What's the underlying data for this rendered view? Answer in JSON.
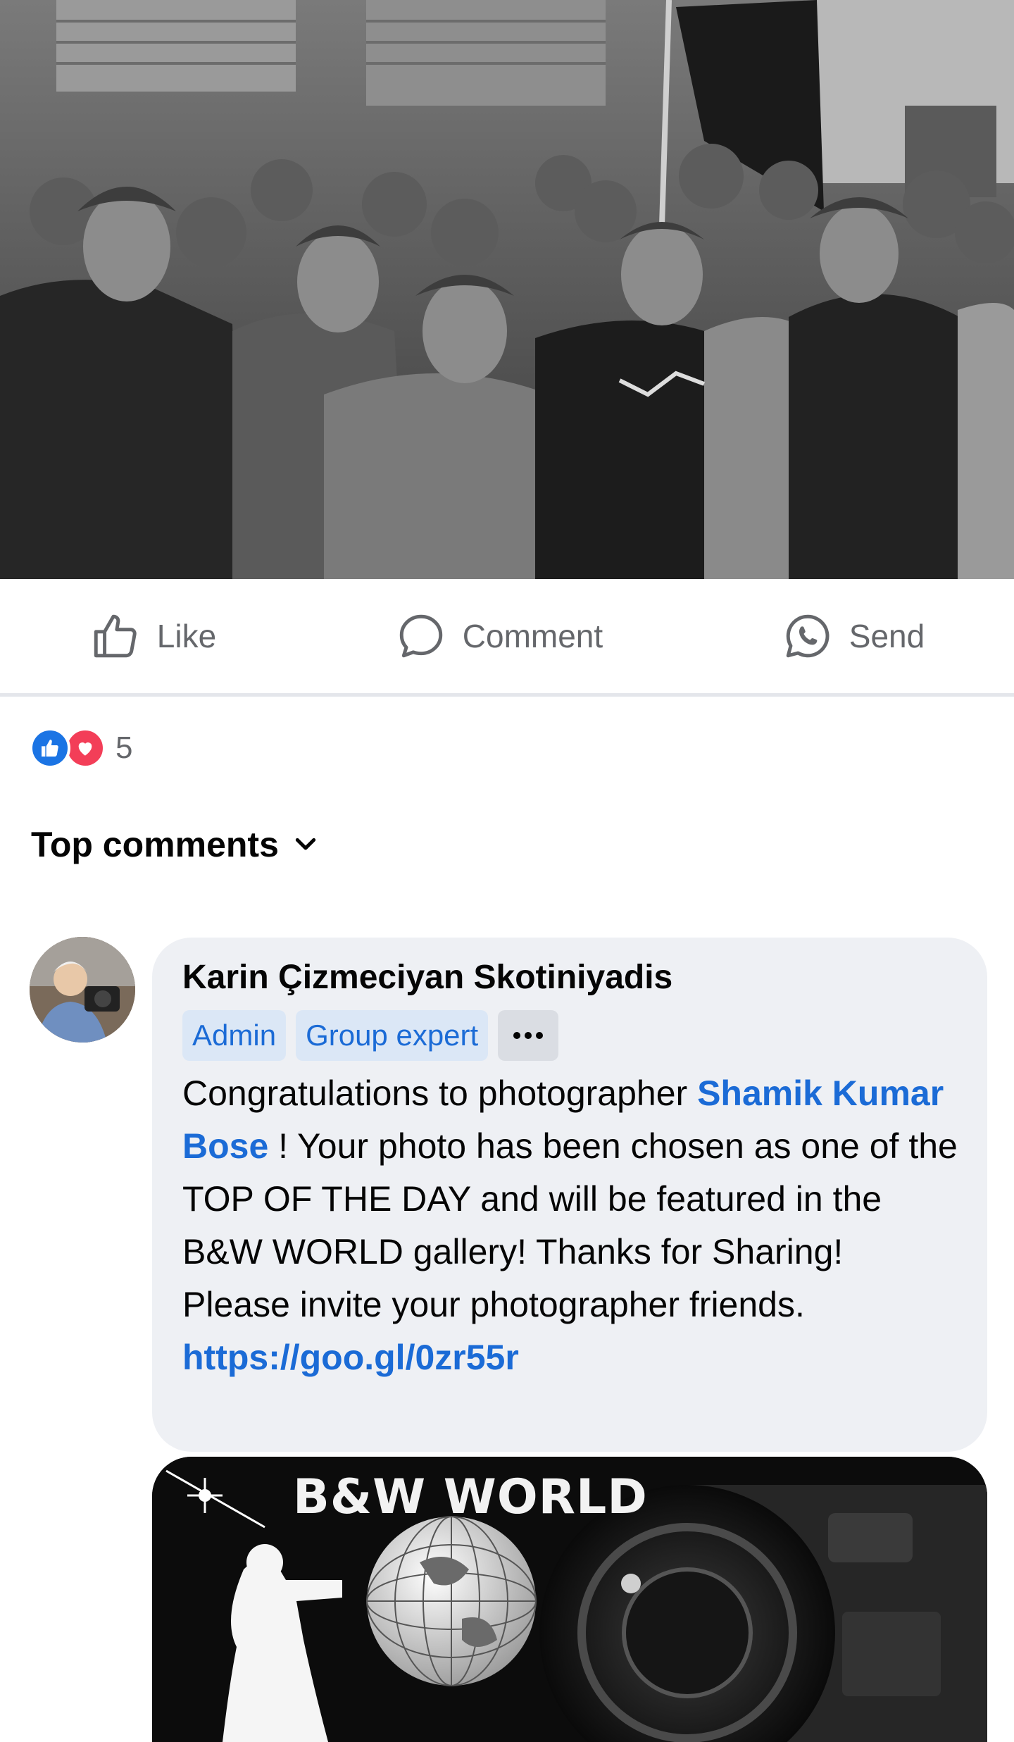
{
  "post": {
    "photo_icon": "street-crowd-photo"
  },
  "actions": {
    "like_label": "Like",
    "comment_label": "Comment",
    "send_label": "Send"
  },
  "reactions": {
    "count": "5",
    "icons": [
      "like-reaction-icon",
      "love-reaction-icon"
    ],
    "like_color": "#1b74e4",
    "love_color": "#f33e58"
  },
  "comments_filter": {
    "label": "Top comments"
  },
  "comment": {
    "author": "Karin Çizmeciyan Skotiniyadis",
    "badges": [
      "Admin",
      "Group expert"
    ],
    "text_before": "Congratulations to photographer ",
    "mention": "Shamik Kumar Bose",
    "text_after": " ! Your photo has been chosen as one of the TOP OF THE DAY and will be featured in the B&W WORLD gallery! Thanks for Sharing! Please invite your photographer friends.",
    "link": "https://goo.gl/0zr55r",
    "attachment_title": "B&W WORLD"
  },
  "colors": {
    "link_blue": "#1b6bd6",
    "bubble_bg": "#eef0f4",
    "badge_bg": "#dbe7f6",
    "icon_gray": "#65676b"
  }
}
